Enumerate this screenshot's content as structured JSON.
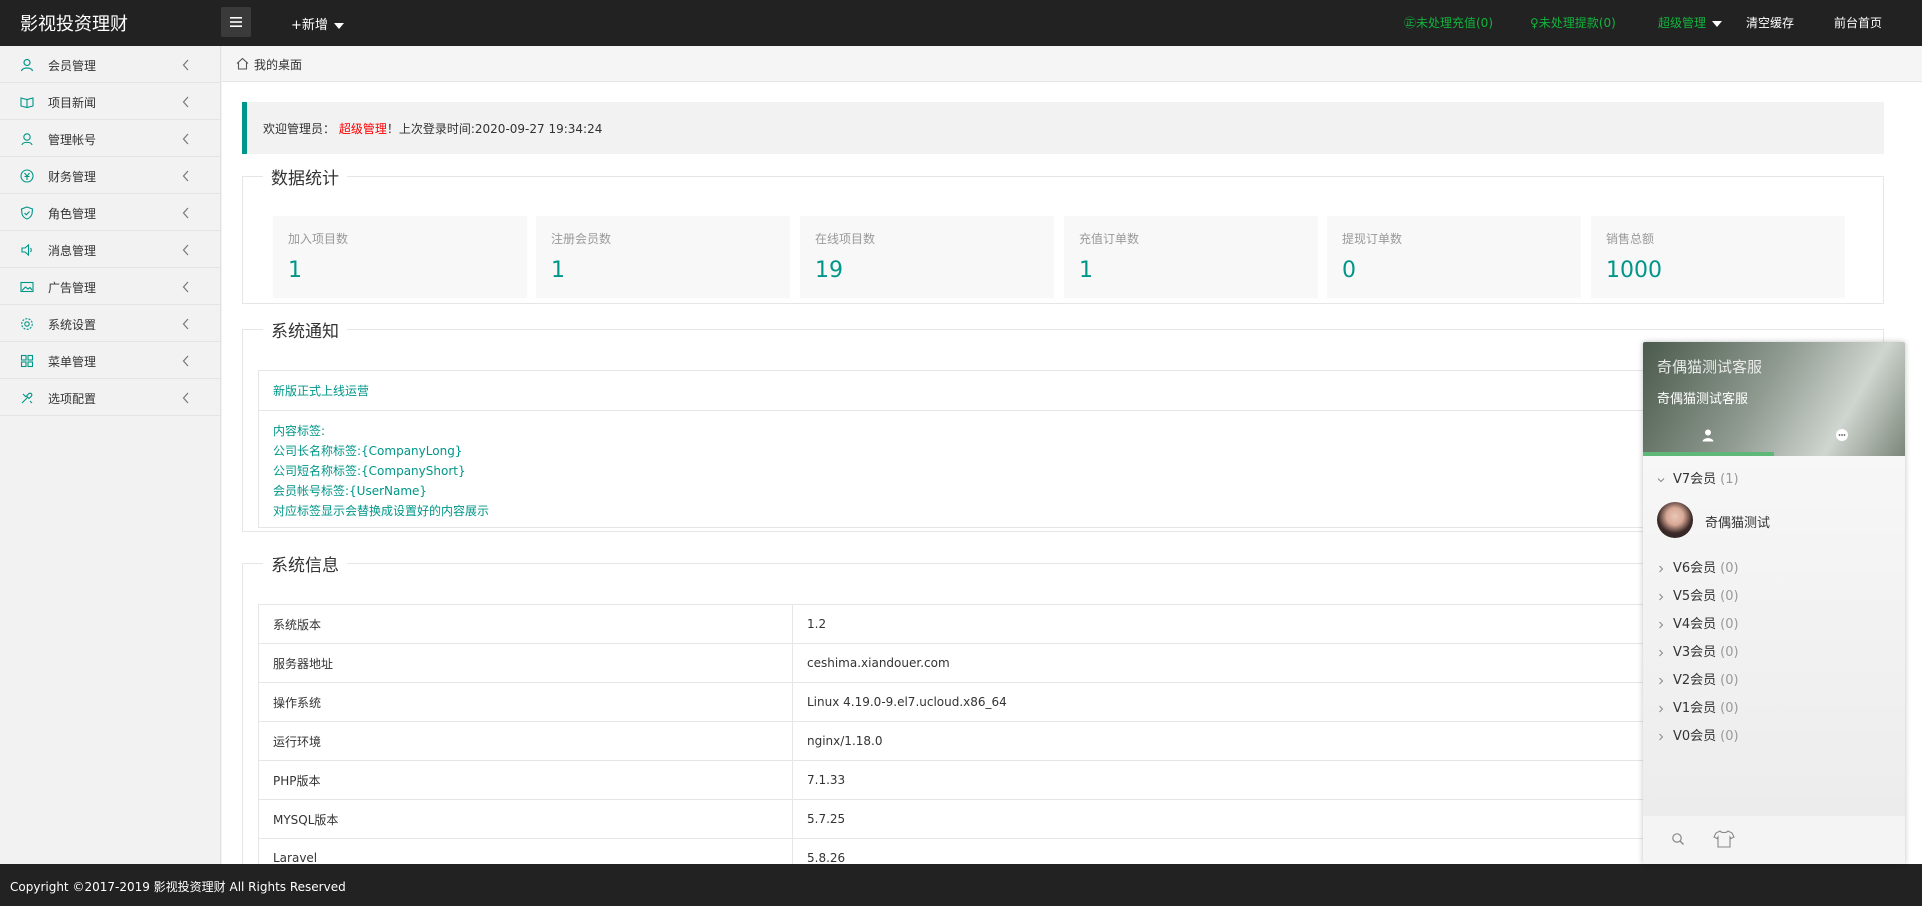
{
  "header": {
    "logo": "影视投资理财",
    "add_new": "+新增",
    "pending_recharge": "㊣未处理充值(0)",
    "pending_withdraw": "♀未处理提款(0)",
    "admin_menu": "超级管理",
    "clear_cache": "清空缓存",
    "front_home": "前台首页"
  },
  "sidebar": {
    "items": [
      {
        "label": "会员管理",
        "icon": "user-icon"
      },
      {
        "label": "项目新闻",
        "icon": "book-icon"
      },
      {
        "label": "管理帐号",
        "icon": "account-icon"
      },
      {
        "label": "财务管理",
        "icon": "finance-icon"
      },
      {
        "label": "角色管理",
        "icon": "shield-icon"
      },
      {
        "label": "消息管理",
        "icon": "speaker-icon"
      },
      {
        "label": "广告管理",
        "icon": "image-icon"
      },
      {
        "label": "系统设置",
        "icon": "gear-icon"
      },
      {
        "label": "菜单管理",
        "icon": "menu-grid-icon"
      },
      {
        "label": "选项配置",
        "icon": "tools-icon"
      }
    ]
  },
  "breadcrumb": {
    "label": "我的桌面"
  },
  "welcome": {
    "prefix": "欢迎管理员：",
    "name": "超级管理",
    "suffix": "！上次登录时间:2020-09-27 19:34:24"
  },
  "stats": {
    "title": "数据统计",
    "items": [
      {
        "label": "加入项目数",
        "value": "1"
      },
      {
        "label": "注册会员数",
        "value": "1"
      },
      {
        "label": "在线项目数",
        "value": "19"
      },
      {
        "label": "充值订单数",
        "value": "1"
      },
      {
        "label": "提现订单数",
        "value": "0"
      },
      {
        "label": "销售总额",
        "value": "1000"
      }
    ]
  },
  "notice": {
    "title": "系统通知",
    "headline": "新版正式上线运营",
    "lines": [
      "内容标签:",
      "公司长名称标签:{CompanyLong}",
      "公司短名称标签:{CompanyShort}",
      "会员帐号标签:{UserName}",
      "对应标签显示会替换成设置好的内容展示"
    ]
  },
  "sysinfo": {
    "title": "系统信息",
    "rows": [
      {
        "key": "系统版本",
        "value": "1.2"
      },
      {
        "key": "服务器地址",
        "value": "ceshima.xiandouer.com"
      },
      {
        "key": "操作系统",
        "value": "Linux 4.19.0-9.el7.ucloud.x86_64"
      },
      {
        "key": "运行环境",
        "value": "nginx/1.18.0"
      },
      {
        "key": "PHP版本",
        "value": "7.1.33"
      },
      {
        "key": "MYSQL版本",
        "value": "5.7.25"
      },
      {
        "key": "Laravel",
        "value": "5.8.26"
      }
    ]
  },
  "footer": {
    "copyright": "Copyright ©2017-2019 影视投资理财 All Rights Reserved"
  },
  "chat": {
    "title": "奇偶猫测试客服",
    "subtitle": "奇偶猫测试客服",
    "groups": [
      {
        "label": "V7会员",
        "count": "(1)"
      },
      {
        "label": "V6会员",
        "count": "(0)"
      },
      {
        "label": "V5会员",
        "count": "(0)"
      },
      {
        "label": "V4会员",
        "count": "(0)"
      },
      {
        "label": "V3会员",
        "count": "(0)"
      },
      {
        "label": "V2会员",
        "count": "(0)"
      },
      {
        "label": "V1会员",
        "count": "(0)"
      },
      {
        "label": "V0会员",
        "count": "(0)"
      }
    ],
    "member": "奇偶猫测试"
  },
  "colors": {
    "accent": "#009688",
    "header_bg": "#222222",
    "pending_green": "#11b43d",
    "welcome_red": "#ff0000",
    "chat_tab_green": "#5fb878"
  }
}
